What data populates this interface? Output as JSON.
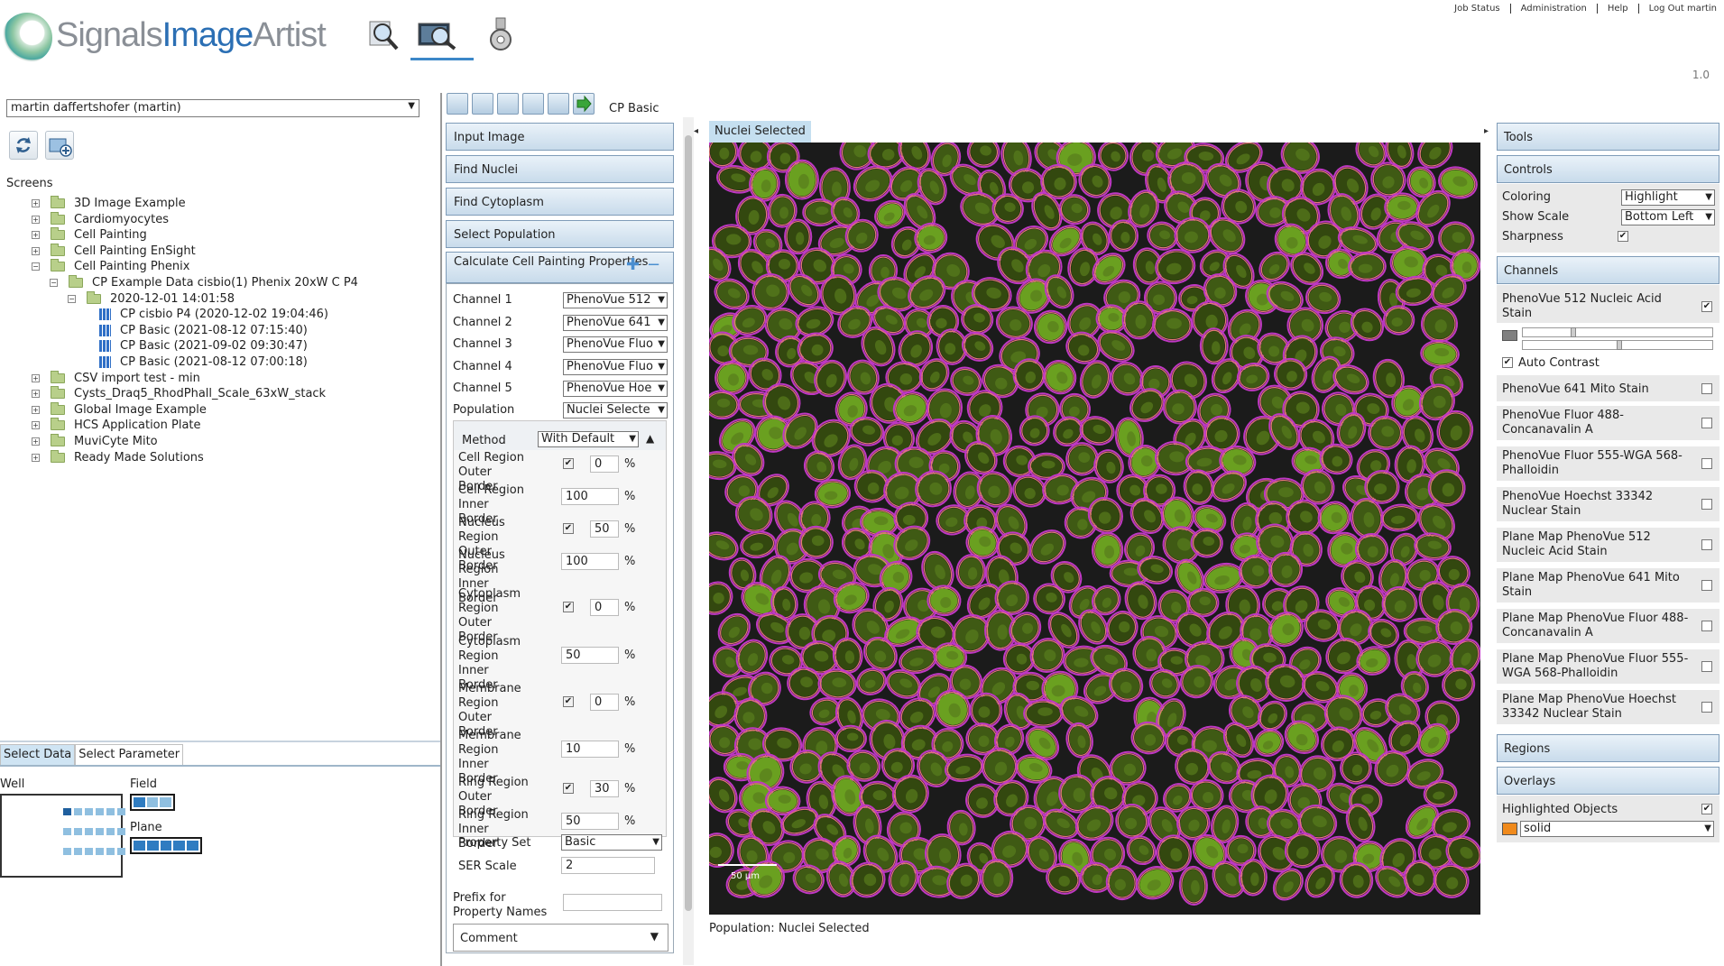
{
  "app": {
    "logo_text_1": "Signals",
    "logo_text_2": "Image",
    "logo_text_3": "Artist",
    "version": "1.0",
    "nav": [
      "Job Status",
      "Administration",
      "Help",
      "Log Out martin"
    ]
  },
  "left": {
    "user_select": "martin daffertshofer (martin)",
    "screens_label": "Screens",
    "tree": [
      {
        "label": "3D Image Example",
        "level": 0,
        "exp": "+",
        "icon": "folder"
      },
      {
        "label": "Cardiomyocytes",
        "level": 0,
        "exp": "+",
        "icon": "folder"
      },
      {
        "label": "Cell Painting",
        "level": 0,
        "exp": "+",
        "icon": "folder"
      },
      {
        "label": "Cell Painting EnSight",
        "level": 0,
        "exp": "+",
        "icon": "folder"
      },
      {
        "label": "Cell Painting Phenix",
        "level": 0,
        "exp": "−",
        "icon": "folder"
      },
      {
        "label": "CP Example Data cisbio(1) Phenix 20xW C P4",
        "level": 1,
        "exp": "−",
        "icon": "folder"
      },
      {
        "label": "2020-12-01 14:01:58",
        "level": 2,
        "exp": "−",
        "icon": "folder"
      },
      {
        "label": "CP cisbio P4 (2020-12-02 19:04:46)",
        "level": 3,
        "exp": "",
        "icon": "grid"
      },
      {
        "label": "CP Basic (2021-08-12 07:15:40)",
        "level": 3,
        "exp": "",
        "icon": "grid"
      },
      {
        "label": "CP Basic (2021-09-02 09:30:47)",
        "level": 3,
        "exp": "",
        "icon": "grid"
      },
      {
        "label": "CP Basic (2021-08-12 07:00:18)",
        "level": 3,
        "exp": "",
        "icon": "grid"
      },
      {
        "label": "CSV import test - min",
        "level": 0,
        "exp": "+",
        "icon": "folder"
      },
      {
        "label": "Cysts_Draq5_RhodPhall_Scale_63xW_stack",
        "level": 0,
        "exp": "+",
        "icon": "folder"
      },
      {
        "label": "Global Image Example",
        "level": 0,
        "exp": "+",
        "icon": "folder"
      },
      {
        "label": "HCS Application Plate",
        "level": 0,
        "exp": "+",
        "icon": "folder"
      },
      {
        "label": "MuviCyte Mito",
        "level": 0,
        "exp": "+",
        "icon": "folder"
      },
      {
        "label": "Ready Made Solutions",
        "level": 0,
        "exp": "+",
        "icon": "folder"
      }
    ],
    "tabs": [
      "Select Data",
      "Select Parameter"
    ],
    "well_label": "Well",
    "field_label": "Field",
    "plane_label": "Plane"
  },
  "workflow": {
    "title": "CP Basic",
    "sections": [
      "Input Image",
      "Find Nuclei",
      "Find Cytoplasm",
      "Select Population"
    ],
    "calc_title": "Calculate Cell Painting Properties",
    "channels": [
      {
        "label": "Channel 1",
        "value": "PhenoVue 512"
      },
      {
        "label": "Channel 2",
        "value": "PhenoVue 641"
      },
      {
        "label": "Channel 3",
        "value": "PhenoVue Fluo"
      },
      {
        "label": "Channel 4",
        "value": "PhenoVue Fluo"
      },
      {
        "label": "Channel 5",
        "value": "PhenoVue Hoe"
      }
    ],
    "population_label": "Population",
    "population_value": "Nuclei Selecte",
    "method_label": "Method",
    "method_value": "With Default",
    "regions": [
      {
        "label": "Cell Region Outer Border",
        "checked": true,
        "value": "0",
        "pct": "%"
      },
      {
        "label": "Cell Region Inner Border",
        "checked": false,
        "value": "100",
        "pct": "%"
      },
      {
        "label": "Nucleus Region Outer Border",
        "checked": true,
        "value": "50",
        "pct": "%"
      },
      {
        "label": "Nucleus Region Inner Border",
        "checked": false,
        "value": "100",
        "pct": "%"
      },
      {
        "label": "Cytoplasm Region Outer Border",
        "checked": true,
        "value": "0",
        "pct": "%"
      },
      {
        "label": "Cytoplasm Region Inner Border",
        "checked": false,
        "value": "50",
        "pct": "%"
      },
      {
        "label": "Membrane Region Outer Border",
        "checked": true,
        "value": "0",
        "pct": "%"
      },
      {
        "label": "Membrane Region Inner Border",
        "checked": false,
        "value": "10",
        "pct": "%"
      },
      {
        "label": "Ring Region Outer Border",
        "checked": true,
        "value": "30",
        "pct": "%"
      },
      {
        "label": "Ring Region Inner Border",
        "checked": false,
        "value": "50",
        "pct": "%"
      }
    ],
    "property_set_label": "Property Set",
    "property_set_value": "Basic",
    "ser_scale_label": "SER Scale",
    "ser_scale_value": "2",
    "prefix_label": "Prefix for Property Names",
    "prefix_value": "",
    "comment_label": "Comment"
  },
  "image": {
    "tab_label": "Nuclei Selected",
    "scale_label": "50 µm",
    "caption": "Population: Nuclei Selected"
  },
  "right": {
    "tools_label": "Tools",
    "controls_label": "Controls",
    "coloring_label": "Coloring",
    "coloring_value": "Highlight",
    "show_scale_label": "Show Scale",
    "show_scale_value": "Bottom Left",
    "sharpness_label": "Sharpness",
    "channels_label": "Channels",
    "channel_first": "PhenoVue 512 Nucleic Acid Stain",
    "auto_contrast_label": "Auto Contrast",
    "channel_list": [
      "PhenoVue 641 Mito Stain",
      "PhenoVue Fluor 488-Concanavalin A",
      "PhenoVue Fluor 555-WGA 568-Phalloidin",
      "PhenoVue Hoechst 33342 Nuclear Stain",
      "Plane Map PhenoVue 512 Nucleic Acid Stain",
      "Plane Map PhenoVue 641 Mito Stain",
      "Plane Map PhenoVue Fluor 488-Concanavalin A",
      "Plane Map PhenoVue Fluor 555-WGA 568-Phalloidin",
      "Plane Map PhenoVue Hoechst 33342 Nuclear Stain"
    ],
    "regions_label": "Regions",
    "overlays_label": "Overlays",
    "highlighted_label": "Highlighted Objects",
    "overlay_style": "solid",
    "overlay_color": "#f08a1c"
  }
}
